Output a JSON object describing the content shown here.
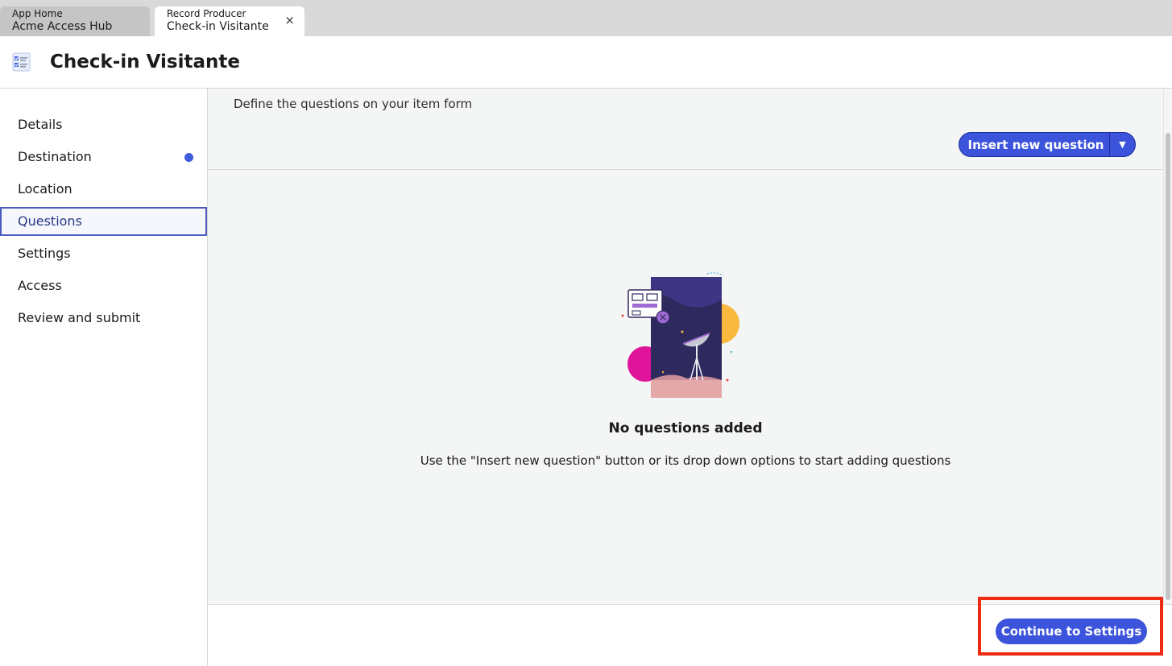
{
  "tabs": [
    {
      "subtitle": "App Home",
      "title": "Acme Access Hub",
      "active": false
    },
    {
      "subtitle": "Record Producer",
      "title": "Check-in Visitante",
      "active": true
    }
  ],
  "tab_close_glyph": "×",
  "header": {
    "title": "Check-in Visitante",
    "icon": "form-checklist-icon"
  },
  "sidebar": {
    "items": [
      {
        "label": "Details"
      },
      {
        "label": "Destination",
        "indicator": true
      },
      {
        "label": "Location"
      },
      {
        "label": "Questions",
        "active": true
      },
      {
        "label": "Settings"
      },
      {
        "label": "Access"
      },
      {
        "label": "Review and submit"
      }
    ]
  },
  "main": {
    "description": "Define the questions on your item form",
    "insert_button_label": "Insert new question",
    "insert_button_caret": "▼",
    "empty_title": "No questions added",
    "empty_message": "Use the \"Insert new question\" button or its drop down options to start adding questions"
  },
  "footer": {
    "continue_label": "Continue to Settings"
  },
  "colors": {
    "accent": "#3b54db",
    "active_nav": "#283a85",
    "highlight": "#ee2a12",
    "indicator_dot": "#3d5bdc"
  }
}
